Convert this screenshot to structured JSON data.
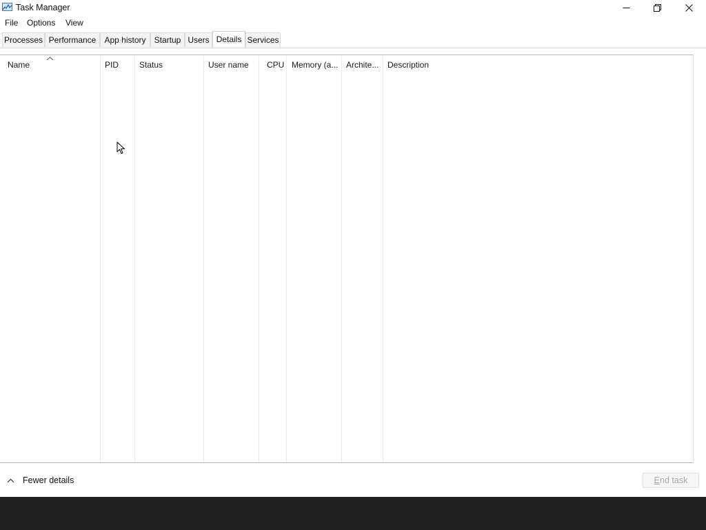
{
  "window": {
    "title": "Task Manager",
    "app_icon": "task-manager-icon"
  },
  "title_buttons": {
    "minimize_icon": "minimize-icon",
    "maximize_icon": "restore-icon",
    "close_icon": "close-icon"
  },
  "menu": {
    "items": [
      "File",
      "Options",
      "View"
    ]
  },
  "tabs": {
    "items": [
      "Processes",
      "Performance",
      "App history",
      "Startup",
      "Users",
      "Details",
      "Services"
    ],
    "active": "Details"
  },
  "table": {
    "columns": [
      "Name",
      "PID",
      "Status",
      "User name",
      "CPU",
      "Memory (a...",
      "Archite...",
      "Description"
    ],
    "sort_icon": "sort-up-icon",
    "rows": []
  },
  "footer": {
    "fewer_details_label": "Fewer details",
    "fewer_details_icon": "chevron-up-icon",
    "end_task_label_first": "E",
    "end_task_label_rest": "nd task"
  },
  "colors": {
    "window_bg": "#ffffff",
    "desktop_bg": "#202020",
    "disabled_text": "#a8a8a8"
  }
}
